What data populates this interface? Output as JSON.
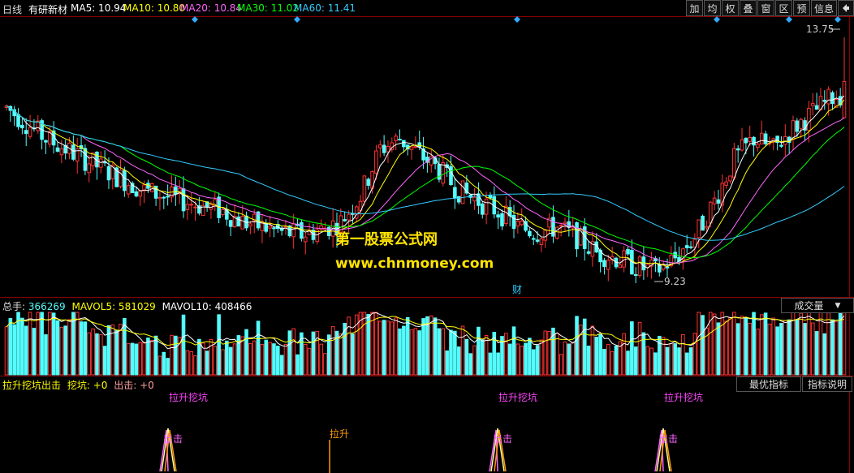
{
  "header": {
    "period": "日线",
    "stock": "有研新材",
    "ma": [
      {
        "label": "MA5: 10.94",
        "color": "#ffffff"
      },
      {
        "label": "MA10: 10.80",
        "color": "#ffff00"
      },
      {
        "label": "MA20: 10.84",
        "color": "#ff66ff"
      },
      {
        "label": "MA30: 11.02",
        "color": "#00ff00"
      },
      {
        "label": "MA60: 11.41",
        "color": "#33ccff"
      }
    ]
  },
  "toolbar": [
    "加",
    "均",
    "权",
    "叠",
    "窗",
    "区",
    "预",
    "信息"
  ],
  "toolbar_icon": "pin-arrow-icon",
  "price": {
    "high_label": "13.75",
    "low_label": "9.23",
    "marker": "财"
  },
  "watermark": {
    "line1": "第一股票公式网",
    "line2": "www.chnmoney.com"
  },
  "volume": {
    "total_label": "总手:",
    "total": "366269",
    "mavol5_label": "MAVOL5: 581029",
    "mavol10_label": "MAVOL10: 408466",
    "dropdown": "成交量"
  },
  "indicator": {
    "name": "拉升挖坑出击",
    "wk_label": "挖坑: +0",
    "cj_label": "出击: +0",
    "btn_best": "最优指标",
    "btn_help": "指标说明",
    "signals": [
      {
        "label": "拉升挖坑",
        "x": 232
      },
      {
        "label": "拉升挖坑",
        "x": 638
      },
      {
        "label": "拉升挖坑",
        "x": 842
      }
    ],
    "spikes": [
      {
        "x": 207,
        "label": "出击"
      },
      {
        "x": 613,
        "label": "出击"
      },
      {
        "x": 817,
        "label": "出击"
      }
    ],
    "lift": {
      "x": 406,
      "label": "拉升"
    }
  },
  "colors": {
    "up": "#ff3232",
    "down": "#54fcfc",
    "ma5": "#ffffff",
    "ma10": "#ffff00",
    "ma20": "#ff66ff",
    "ma30": "#00ff00",
    "ma60": "#33ccff",
    "grid": "#8b0000"
  },
  "chart_data": {
    "type": "candlestick",
    "ylim": [
      9.0,
      14.0
    ],
    "n_bars": 170,
    "close_anchors": [
      [
        0,
        12.4
      ],
      [
        5,
        12.1
      ],
      [
        10,
        11.8
      ],
      [
        15,
        11.6
      ],
      [
        20,
        11.4
      ],
      [
        25,
        11.2
      ],
      [
        30,
        11.0
      ],
      [
        35,
        10.8
      ],
      [
        40,
        10.7
      ],
      [
        45,
        10.6
      ],
      [
        50,
        10.5
      ],
      [
        55,
        10.4
      ],
      [
        60,
        10.2
      ],
      [
        65,
        10.1
      ],
      [
        70,
        10.0
      ],
      [
        75,
        9.95
      ],
      [
        80,
        10.05
      ],
      [
        85,
        10.2
      ],
      [
        90,
        10.7
      ],
      [
        95,
        11.6
      ],
      [
        100,
        11.8
      ],
      [
        105,
        11.5
      ],
      [
        110,
        11.2
      ],
      [
        115,
        10.8
      ],
      [
        120,
        10.6
      ],
      [
        125,
        10.4
      ],
      [
        130,
        10.1
      ],
      [
        135,
        10.0
      ],
      [
        140,
        10.1
      ],
      [
        145,
        9.9
      ],
      [
        150,
        9.6
      ],
      [
        155,
        9.5
      ],
      [
        160,
        9.35
      ],
      [
        165,
        9.25
      ],
      [
        170,
        9.5
      ],
      [
        175,
        9.9
      ],
      [
        180,
        10.6
      ],
      [
        185,
        11.4
      ],
      [
        190,
        11.8
      ],
      [
        195,
        11.6
      ],
      [
        200,
        12.0
      ],
      [
        205,
        12.3
      ],
      [
        210,
        12.6
      ],
      [
        214,
        12.7
      ]
    ],
    "high": 13.75,
    "low": 9.23
  }
}
